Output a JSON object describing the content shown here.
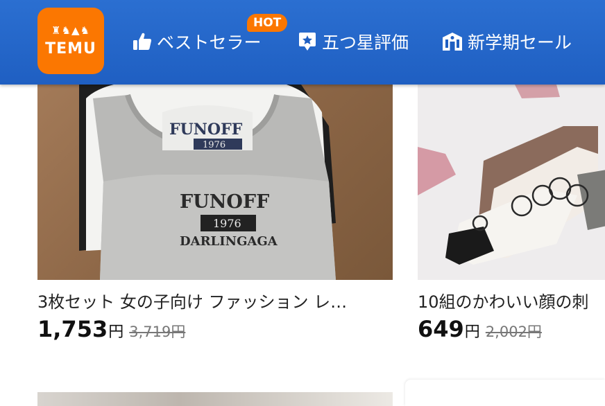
{
  "header": {
    "logo_text": "TEMU",
    "hot_badge": "HOT",
    "nav": [
      {
        "label": "ベストセラー",
        "icon": "thumbs-up-icon"
      },
      {
        "label": "五つ星評価",
        "icon": "star-badge-icon"
      },
      {
        "label": "新学期セール",
        "icon": "school-icon"
      }
    ]
  },
  "products": [
    {
      "title": "3枚セット 女の子向け ファッション レ…",
      "price": "1,753",
      "currency": "円",
      "original_price": "3,719円",
      "image": {
        "top_print": "FUNOFF",
        "top_year": "1976",
        "print": "FUNOFF",
        "year": "1976",
        "sub": "DARLINGAGA"
      }
    },
    {
      "title": "10組のかわいい顔の刺",
      "price": "649",
      "currency": "円",
      "original_price": "2,002円"
    }
  ],
  "colors": {
    "header": "#1f5fc2",
    "brand_orange": "#fb7701"
  }
}
